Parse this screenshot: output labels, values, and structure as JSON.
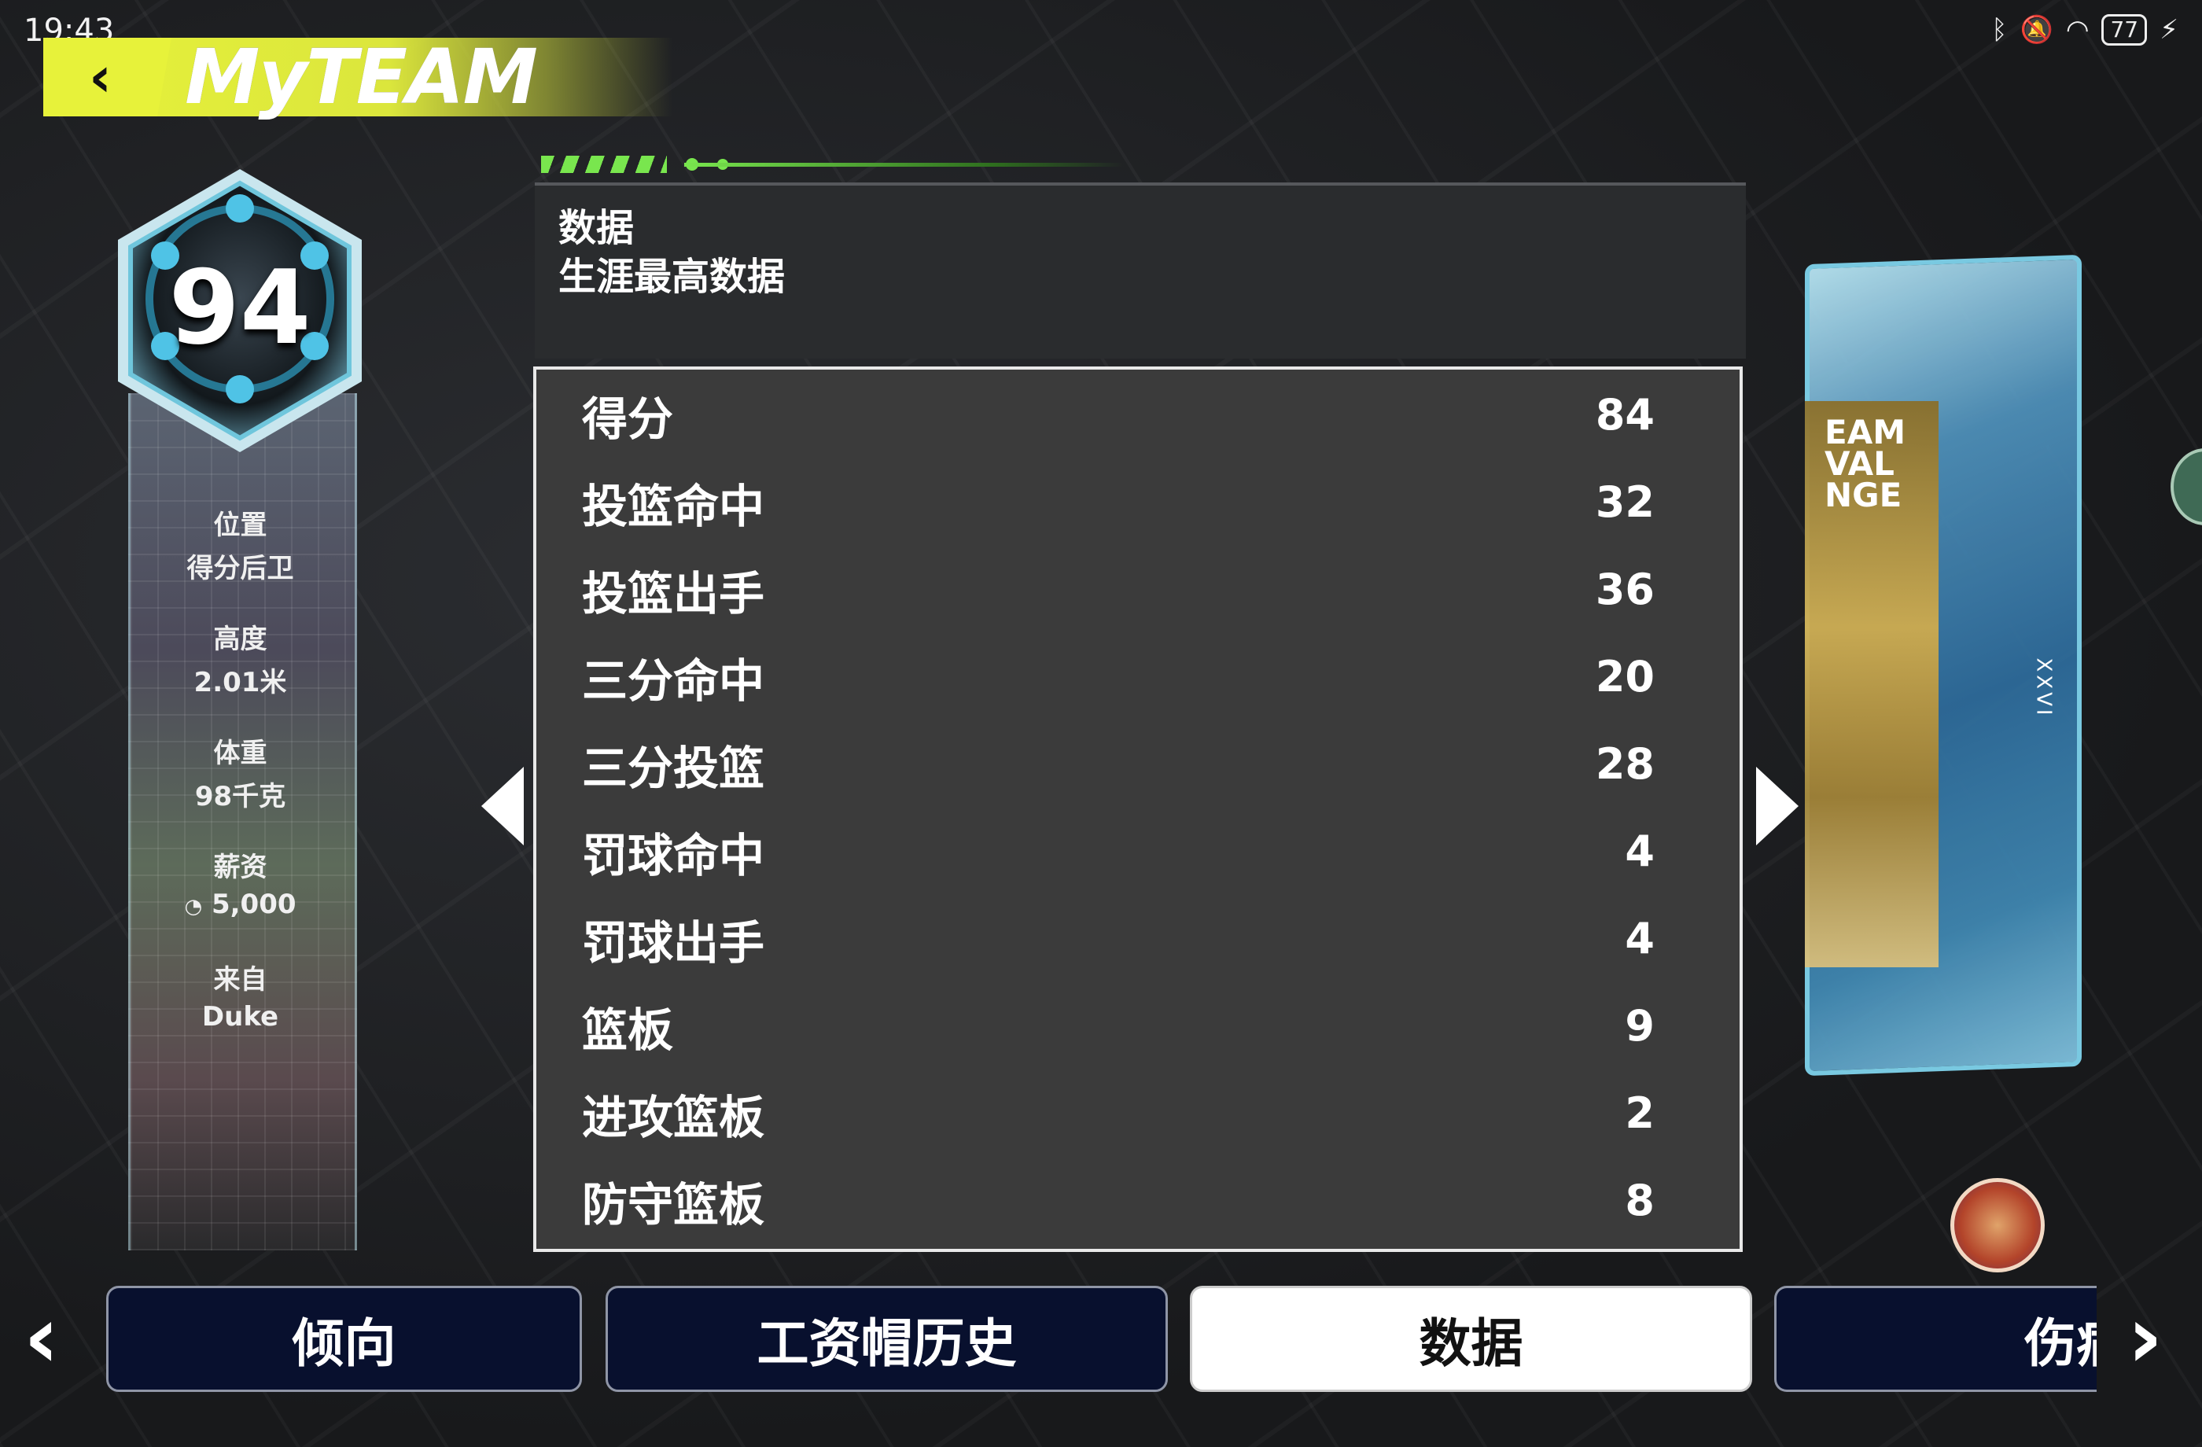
{
  "status_bar": {
    "time": "19:43",
    "battery": "77",
    "icons": [
      "bluetooth-icon",
      "mute-icon",
      "wifi-icon",
      "battery-icon",
      "charging-icon"
    ]
  },
  "header": {
    "back_glyph": "‹",
    "logo_text": "MyTEAM"
  },
  "player": {
    "overall": "94",
    "position_label": "位置",
    "position_value": "得分后卫",
    "height_label": "高度",
    "height_value": "2.01米",
    "weight_label": "体重",
    "weight_value": "98千克",
    "salary_label": "薪资",
    "salary_value": "5,000",
    "from_label": "来自",
    "from_value": "Duke"
  },
  "panel": {
    "title": "数据",
    "subtitle": "生涯最高数据"
  },
  "stats": [
    {
      "label": "得分",
      "value": "84"
    },
    {
      "label": "投篮命中",
      "value": "32"
    },
    {
      "label": "投篮出手",
      "value": "36"
    },
    {
      "label": "三分命中",
      "value": "20"
    },
    {
      "label": "三分投篮",
      "value": "28"
    },
    {
      "label": "罚球命中",
      "value": "4"
    },
    {
      "label": "罚球出手",
      "value": "4"
    },
    {
      "label": "篮板",
      "value": "9"
    },
    {
      "label": "进攻篮板",
      "value": "2"
    },
    {
      "label": "防守篮板",
      "value": "8"
    }
  ],
  "card": {
    "text_lines": [
      "EAM",
      "VAL",
      "NGE"
    ],
    "xxvi": "XXVI"
  },
  "tabs": [
    {
      "label": "倾向",
      "active": false
    },
    {
      "label": "工资帽历史",
      "active": false
    },
    {
      "label": "数据",
      "active": true
    },
    {
      "label": "伤病",
      "active": false
    }
  ],
  "tab_nav": {
    "prev": "‹",
    "next": "›"
  },
  "colors": {
    "accent": "#e7f23a",
    "tab_dark": "#08102e",
    "progress_green": "#79e64e"
  }
}
